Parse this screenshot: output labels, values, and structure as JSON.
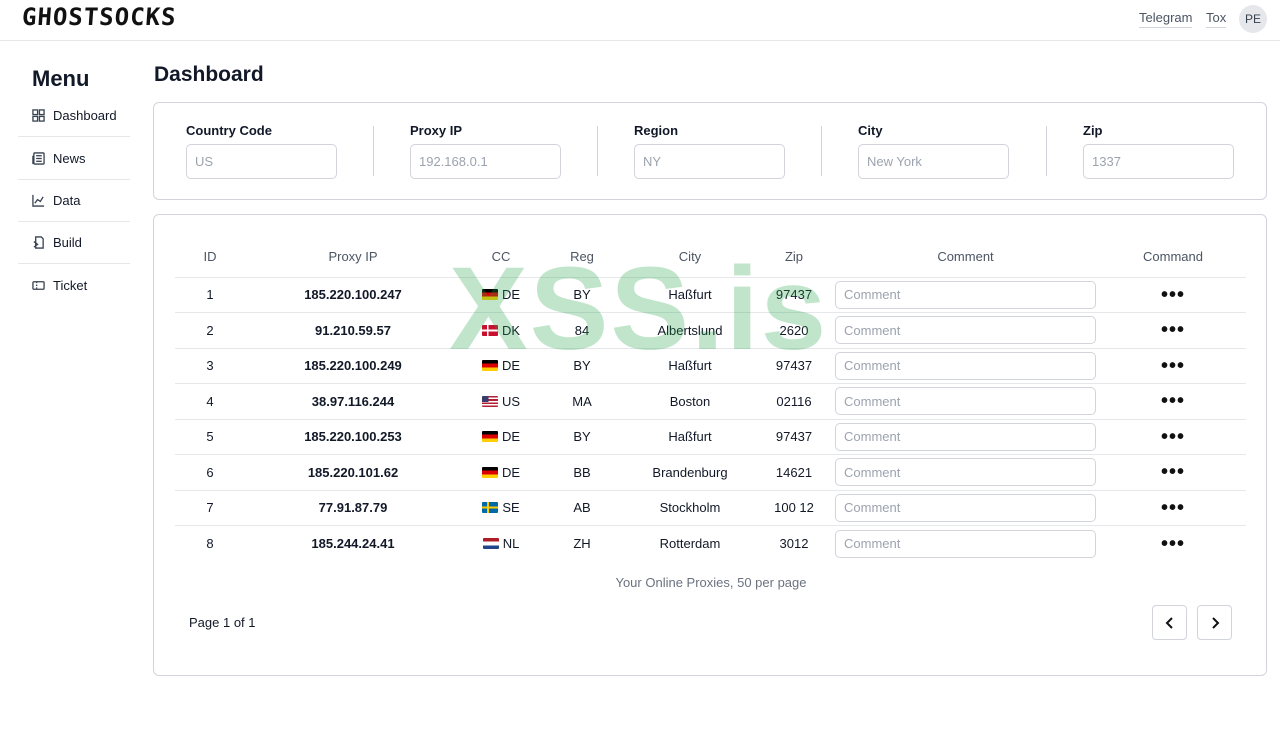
{
  "brand": {
    "logo_text": "GHOSTSOCKS"
  },
  "topnav": {
    "telegram": "Telegram",
    "tox": "Tox",
    "avatar_initials": "PE"
  },
  "sidebar": {
    "title": "Menu",
    "items": [
      {
        "label": "Dashboard",
        "icon": "dashboard-icon"
      },
      {
        "label": "News",
        "icon": "news-icon"
      },
      {
        "label": "Data",
        "icon": "chart-icon"
      },
      {
        "label": "Build",
        "icon": "build-icon"
      },
      {
        "label": "Ticket",
        "icon": "ticket-icon"
      }
    ]
  },
  "page": {
    "title": "Dashboard"
  },
  "filters": [
    {
      "label": "Country Code",
      "placeholder": "US",
      "value": ""
    },
    {
      "label": "Proxy IP",
      "placeholder": "192.168.0.1",
      "value": ""
    },
    {
      "label": "Region",
      "placeholder": "NY",
      "value": ""
    },
    {
      "label": "City",
      "placeholder": "New York",
      "value": ""
    },
    {
      "label": "Zip",
      "placeholder": "1337",
      "value": ""
    }
  ],
  "watermark": "XSS.is",
  "table": {
    "headers": [
      "ID",
      "Proxy IP",
      "CC",
      "Reg",
      "City",
      "Zip",
      "Comment",
      "Command"
    ],
    "comment_placeholder": "Comment",
    "command_symbol": "•••",
    "rows": [
      {
        "id": "1",
        "ip": "185.220.100.247",
        "cc": "DE",
        "reg": "BY",
        "city": "Haßfurt",
        "zip": "97437"
      },
      {
        "id": "2",
        "ip": "91.210.59.57",
        "cc": "DK",
        "reg": "84",
        "city": "Albertslund",
        "zip": "2620"
      },
      {
        "id": "3",
        "ip": "185.220.100.249",
        "cc": "DE",
        "reg": "BY",
        "city": "Haßfurt",
        "zip": "97437"
      },
      {
        "id": "4",
        "ip": "38.97.116.244",
        "cc": "US",
        "reg": "MA",
        "city": "Boston",
        "zip": "02116"
      },
      {
        "id": "5",
        "ip": "185.220.100.253",
        "cc": "DE",
        "reg": "BY",
        "city": "Haßfurt",
        "zip": "97437"
      },
      {
        "id": "6",
        "ip": "185.220.101.62",
        "cc": "DE",
        "reg": "BB",
        "city": "Brandenburg",
        "zip": "14621"
      },
      {
        "id": "7",
        "ip": "77.91.87.79",
        "cc": "SE",
        "reg": "AB",
        "city": "Stockholm",
        "zip": "100 12"
      },
      {
        "id": "8",
        "ip": "185.244.24.41",
        "cc": "NL",
        "reg": "ZH",
        "city": "Rotterdam",
        "zip": "3012"
      }
    ],
    "caption": "Your Online Proxies, 50 per page"
  },
  "pagination": {
    "info": "Page 1 of 1",
    "prev_icon": "chevron-left-icon",
    "next_icon": "chevron-right-icon"
  },
  "colors": {
    "watermark": "#22a046",
    "border": "#d1d5db",
    "text": "#111827"
  }
}
